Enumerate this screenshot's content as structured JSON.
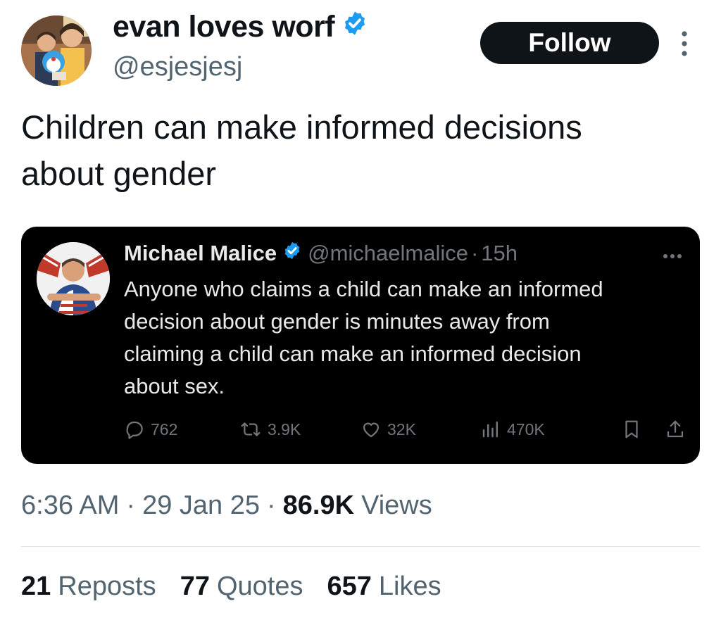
{
  "author": {
    "display_name": "evan loves worf",
    "handle": "@esjesjesj",
    "verified": true
  },
  "follow_button_label": "Follow",
  "tweet_text_lines": [
    "Children can make informed decisions",
    "about gender"
  ],
  "quoted_tweet": {
    "display_name": "Michael Malice",
    "handle": "@michaelmalice",
    "separator": "·",
    "time": "15h",
    "verified": true,
    "text_lines": [
      "Anyone who claims a child can make an informed",
      "decision about gender is minutes away from",
      "claiming a child can make an informed decision",
      "about sex."
    ],
    "actions": {
      "replies": "762",
      "reposts": "3.9K",
      "likes": "32K",
      "views": "470K"
    }
  },
  "meta": {
    "time": "6:36 AM",
    "sep1": "·",
    "date": "29 Jan 25",
    "sep2": "·",
    "views_count": "86.9K",
    "views_label": "Views"
  },
  "stats": {
    "reposts_count": "21",
    "reposts_label": "Reposts",
    "quotes_count": "77",
    "quotes_label": "Quotes",
    "likes_count": "657",
    "likes_label": "Likes"
  },
  "colors": {
    "verified_blue": "#1d9bf0",
    "text_primary": "#0f1419",
    "text_secondary": "#536471",
    "quote_bg": "#000000",
    "quote_secondary": "#71767b"
  },
  "icons": [
    "more-vertical-icon",
    "verified-badge-icon",
    "more-horizontal-icon",
    "reply-icon",
    "repost-icon",
    "like-icon",
    "views-icon",
    "bookmark-icon",
    "share-icon"
  ]
}
